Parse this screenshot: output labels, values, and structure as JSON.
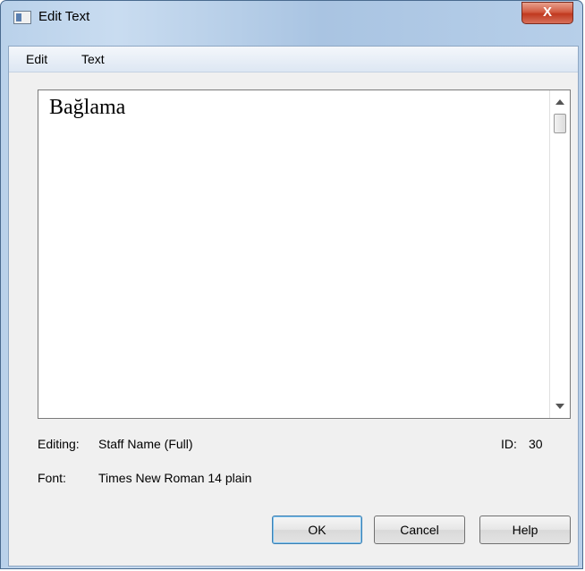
{
  "window": {
    "title": "Edit Text",
    "close_label": "X"
  },
  "menu": {
    "items": [
      "Edit",
      "Text"
    ]
  },
  "editor": {
    "content": "Bağlama"
  },
  "info": {
    "editing_label": "Editing:",
    "editing_value": "Staff Name (Full)",
    "id_label": "ID:",
    "id_value": "30",
    "font_label": "Font:",
    "font_value": "Times New Roman 14 plain"
  },
  "buttons": {
    "ok": "OK",
    "cancel": "Cancel",
    "help": "Help"
  },
  "icons": {
    "app": "window-icon",
    "close": "close-icon",
    "scroll_up": "arrow-up-icon",
    "scroll_down": "arrow-down-icon"
  }
}
